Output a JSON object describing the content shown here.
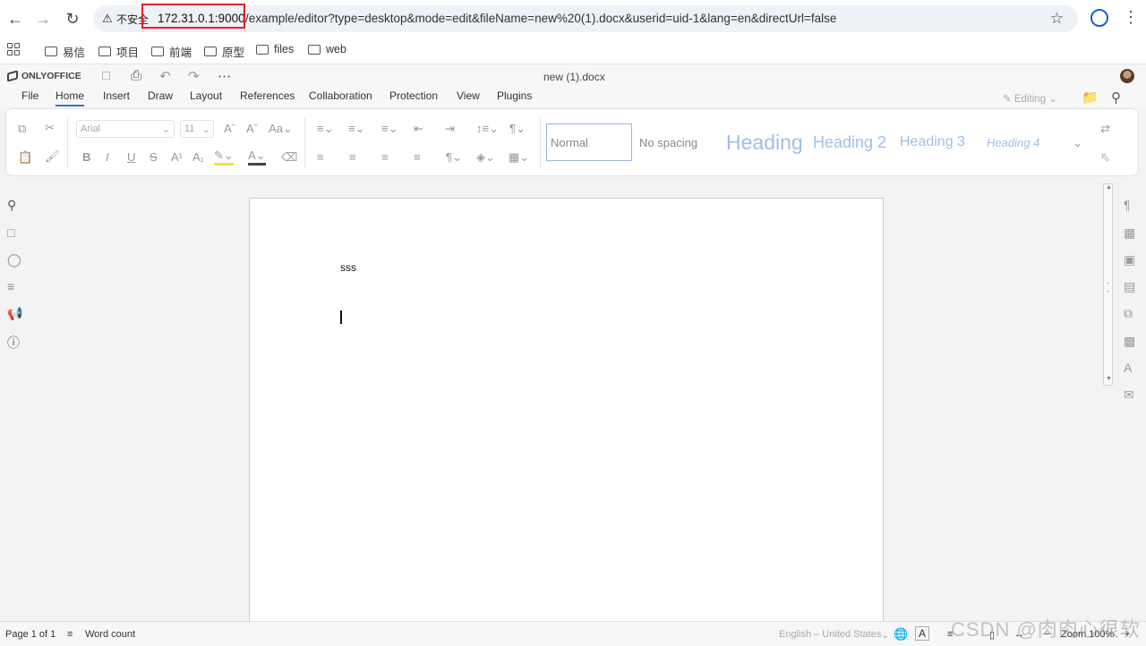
{
  "browser": {
    "security_label": "不安全",
    "url_host": "172.31.0.1:9000",
    "url_path": "/example/editor?type=desktop&mode=edit&fileName=new%20(1).docx&userid=uid-1&lang=en&directUrl=false",
    "highlight_color": "#e0202a"
  },
  "bookmarks": [
    {
      "label": "易信"
    },
    {
      "label": "项目"
    },
    {
      "label": "前端"
    },
    {
      "label": "原型"
    },
    {
      "label": "files"
    },
    {
      "label": "web"
    }
  ],
  "editor": {
    "brand": "ONLYOFFICE",
    "document_title": "new (1).docx",
    "menu_tabs": [
      "File",
      "Home",
      "Insert",
      "Draw",
      "Layout",
      "References",
      "Collaboration",
      "Protection",
      "View",
      "Plugins"
    ],
    "active_tab": "Home",
    "mode_label": "Editing",
    "accent_color": "#3d6cc5"
  },
  "toolbar": {
    "font_name": "Arial",
    "font_size": "11",
    "styles": [
      "Normal",
      "No spacing",
      "Heading",
      "Heading 2",
      "Heading 3",
      "Heading 4"
    ]
  },
  "document": {
    "body_text": "sss"
  },
  "statusbar": {
    "page_info": "Page 1 of 1",
    "word_count": "Word count",
    "language": "English – United States",
    "zoom": "Zoom 100%"
  },
  "watermark": "CSDN @肉肉心很软"
}
